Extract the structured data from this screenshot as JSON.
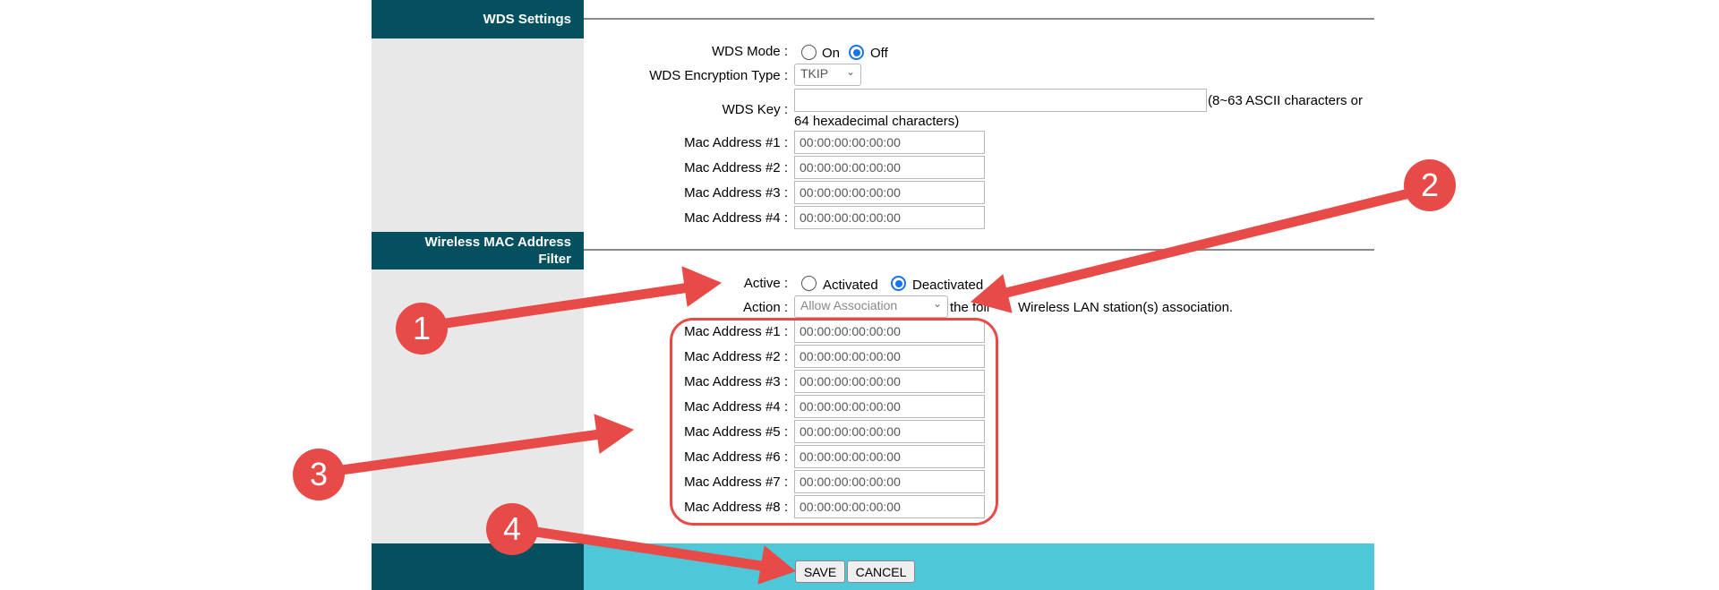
{
  "wds": {
    "header": "WDS Settings",
    "mode_label": "WDS Mode :",
    "mode_on": "On",
    "mode_off": "Off",
    "encryption_label": "WDS Encryption Type :",
    "encryption_value": "TKIP",
    "key_label": "WDS Key :",
    "key_value": "",
    "key_hint_1": "(8~63 ASCII characters or",
    "key_hint_2": "64 hexadecimal characters)",
    "mac_labels": [
      "Mac Address #1 :",
      "Mac Address #2 :",
      "Mac Address #3 :",
      "Mac Address #4 :"
    ],
    "mac_values": [
      "00:00:00:00:00:00",
      "00:00:00:00:00:00",
      "00:00:00:00:00:00",
      "00:00:00:00:00:00"
    ]
  },
  "macfilter": {
    "header_1": "Wireless MAC Address",
    "header_2": "Filter",
    "active_label": "Active :",
    "activated": "Activated",
    "deactivated": "Deactivated",
    "action_label": "Action :",
    "action_value": "Allow Association",
    "action_suffix_a": "the foll",
    "action_suffix_b": "Wireless LAN station(s) association.",
    "mac_labels": [
      "Mac Address #1 :",
      "Mac Address #2 :",
      "Mac Address #3 :",
      "Mac Address #4 :",
      "Mac Address #5 :",
      "Mac Address #6 :",
      "Mac Address #7 :",
      "Mac Address #8 :"
    ],
    "mac_values": [
      "00:00:00:00:00:00",
      "00:00:00:00:00:00",
      "00:00:00:00:00:00",
      "00:00:00:00:00:00",
      "00:00:00:00:00:00",
      "00:00:00:00:00:00",
      "00:00:00:00:00:00",
      "00:00:00:00:00:00"
    ]
  },
  "buttons": {
    "save": "SAVE",
    "cancel": "CANCEL"
  },
  "annotations": {
    "b1": "1",
    "b2": "2",
    "b3": "3",
    "b4": "4"
  },
  "colors": {
    "header_bg": "#04505e",
    "footer_bg": "#4ec8d8",
    "annotation_red": "#e84a47",
    "radio_blue": "#1a73e8"
  }
}
